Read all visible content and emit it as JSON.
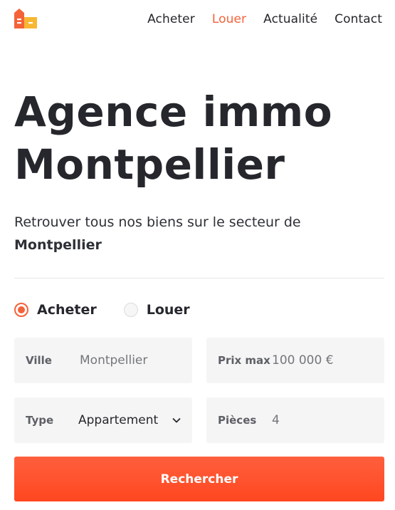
{
  "header": {
    "logo_icon": "buildings-logo-icon",
    "nav": [
      {
        "label": "Acheter",
        "active": false
      },
      {
        "label": "Louer",
        "active": true
      },
      {
        "label": "Actualité",
        "active": false
      },
      {
        "label": "Contact",
        "active": false
      }
    ]
  },
  "hero": {
    "title_line1": "Agence immo",
    "title_line2": "Montpellier",
    "subtitle": "Retrouver tous nos biens sur le secteur de",
    "subtitle_bold": "Montpellier"
  },
  "search": {
    "mode_options": [
      {
        "label": "Acheter",
        "selected": true
      },
      {
        "label": "Louer",
        "selected": false
      }
    ],
    "ville": {
      "label": "Ville",
      "placeholder": "Montpellier"
    },
    "prix_max": {
      "label": "Prix max",
      "placeholder": "100 000 €"
    },
    "type": {
      "label": "Type",
      "value": "Appartement"
    },
    "pieces": {
      "label": "Pièces",
      "placeholder": "4"
    },
    "submit_label": "Rechercher"
  },
  "colors": {
    "accent": "#f4623a",
    "button": "#ff5330",
    "text": "#25272d",
    "field_bg": "#f5f5f5"
  }
}
